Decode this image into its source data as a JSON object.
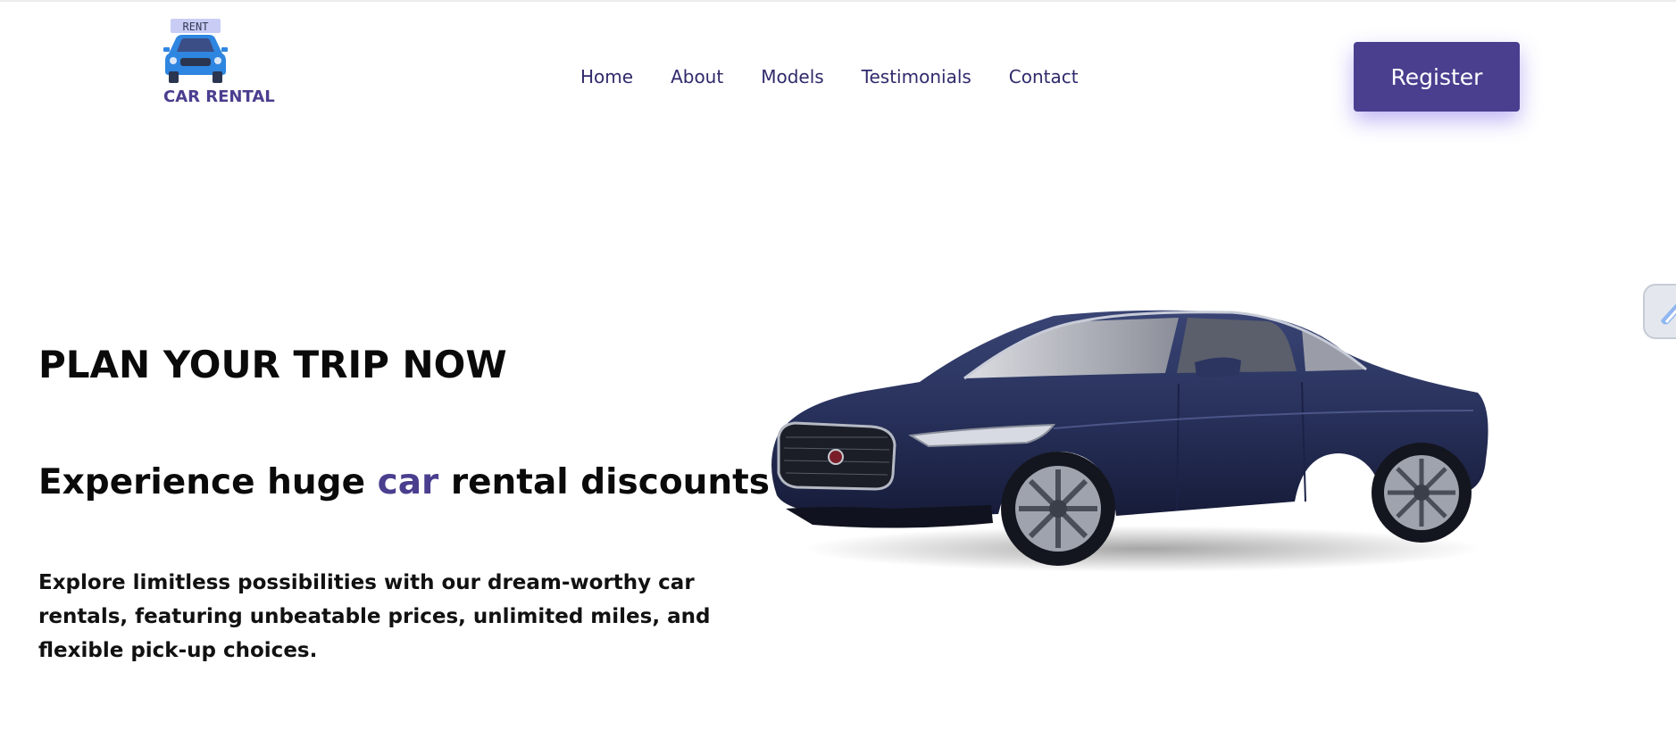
{
  "brand": {
    "name": "CAR RENTAL",
    "sign_text": "RENT",
    "logo_icon": "car-front-icon",
    "color": "#4a3e8f"
  },
  "nav": {
    "items": [
      {
        "label": "Home"
      },
      {
        "label": "About"
      },
      {
        "label": "Models"
      },
      {
        "label": "Testimonials"
      },
      {
        "label": "Contact"
      }
    ]
  },
  "header": {
    "register_label": "Register"
  },
  "hero": {
    "title": "PLAN YOUR TRIP NOW",
    "subtitle_before": "Experience huge ",
    "subtitle_highlight": "car",
    "subtitle_after": " rental discounts",
    "description": "Explore limitless possibilities with our dream-worthy car rentals, featuring unbeatable prices, unlimited miles, and flexible pick-up choices.",
    "image": "dark-blue-sedan-image",
    "accent_color": "#4a3e8f"
  },
  "side_widget": {
    "icon": "tool-icon"
  }
}
